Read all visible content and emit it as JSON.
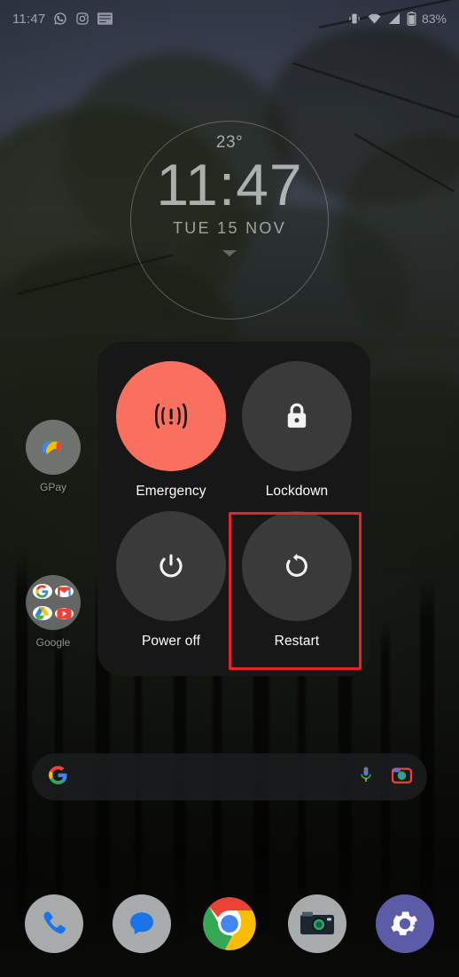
{
  "meta": {
    "screen": "android-home-screen-with-power-menu",
    "accent_emergency": "#f9705f",
    "accent_highlight": "#e8232a",
    "dialog_bg": "#171717",
    "button_bg": "#3a3a3a"
  },
  "status_bar": {
    "clock": "11:47",
    "notification_icons": [
      {
        "name": "whatsapp-icon",
        "label": "WhatsApp"
      },
      {
        "name": "instagram-icon",
        "label": "Instagram"
      },
      {
        "name": "list-notification-icon",
        "label": "Notification"
      }
    ],
    "system_icons": [
      {
        "name": "vibrate-icon",
        "label": "Vibrate"
      },
      {
        "name": "wifi-icon",
        "label": "Wi-Fi"
      },
      {
        "name": "signal-icon",
        "label": "Mobile signal"
      },
      {
        "name": "battery-icon",
        "label": "Battery"
      }
    ],
    "battery_percent": "83%"
  },
  "clock_widget": {
    "temperature": "23°",
    "time": "11:47",
    "date": "TUE  15  NOV"
  },
  "home_apps": [
    {
      "name": "gpay",
      "label": "GPay"
    },
    {
      "name": "google-folder",
      "label": "Google"
    }
  ],
  "search_bar": {
    "logo": "google-g-icon",
    "mic": "microphone-icon",
    "lens": "google-lens-icon",
    "placeholder": ""
  },
  "dock": [
    {
      "name": "phone",
      "label": "Phone"
    },
    {
      "name": "messages",
      "label": "Messages"
    },
    {
      "name": "chrome",
      "label": "Chrome"
    },
    {
      "name": "camera",
      "label": "Camera"
    },
    {
      "name": "settings",
      "label": "Settings"
    }
  ],
  "power_menu": {
    "items": [
      {
        "key": "emergency",
        "label": "Emergency",
        "icon": "emergency-broadcast-icon",
        "highlighted": false
      },
      {
        "key": "lockdown",
        "label": "Lockdown",
        "icon": "lock-icon",
        "highlighted": false
      },
      {
        "key": "power_off",
        "label": "Power off",
        "icon": "power-icon",
        "highlighted": false
      },
      {
        "key": "restart",
        "label": "Restart",
        "icon": "restart-icon",
        "highlighted": true
      }
    ]
  }
}
